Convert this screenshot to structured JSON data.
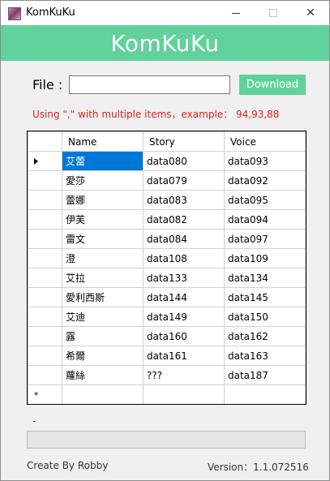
{
  "window": {
    "title": "KomKuKu",
    "minimize_glyph": "",
    "maximize_glyph": "",
    "close_glyph": "✕"
  },
  "header": {
    "title": "KomKuKu",
    "color": "#61d29b"
  },
  "file": {
    "label": "File :",
    "value": "",
    "placeholder": "",
    "download_label": "Download"
  },
  "hint": "Using \",\" with multiple items，example： 94,93,88",
  "grid": {
    "columns": [
      "Name",
      "Story",
      "Voice"
    ],
    "rows": [
      {
        "name": "艾蕾",
        "story": "data080",
        "voice": "data093"
      },
      {
        "name": "愛莎",
        "story": "data079",
        "voice": "data092"
      },
      {
        "name": "蕾娜",
        "story": "data083",
        "voice": "data095"
      },
      {
        "name": "伊芙",
        "story": "data082",
        "voice": "data094"
      },
      {
        "name": "雷文",
        "story": "data084",
        "voice": "data097"
      },
      {
        "name": "澄",
        "story": "data108",
        "voice": "data109"
      },
      {
        "name": "艾拉",
        "story": "data133",
        "voice": "data134"
      },
      {
        "name": "愛利西斯",
        "story": "data144",
        "voice": "data145"
      },
      {
        "name": "艾迪",
        "story": "data149",
        "voice": "data150"
      },
      {
        "name": "露",
        "story": "data160",
        "voice": "data162"
      },
      {
        "name": "希爾",
        "story": "data161",
        "voice": "data163"
      },
      {
        "name": "蘿絲",
        "story": "???",
        "voice": "data187"
      }
    ],
    "new_row_marker": "*",
    "selected_color": "#0078d7"
  },
  "status": {
    "text": "-",
    "progress": 0
  },
  "footer": {
    "credit": "Create By Robby",
    "version": "Version：1.1.072516"
  },
  "icons": [
    "app-icon",
    "minimize-icon",
    "maximize-icon",
    "close-icon",
    "current-row-arrow-icon"
  ]
}
